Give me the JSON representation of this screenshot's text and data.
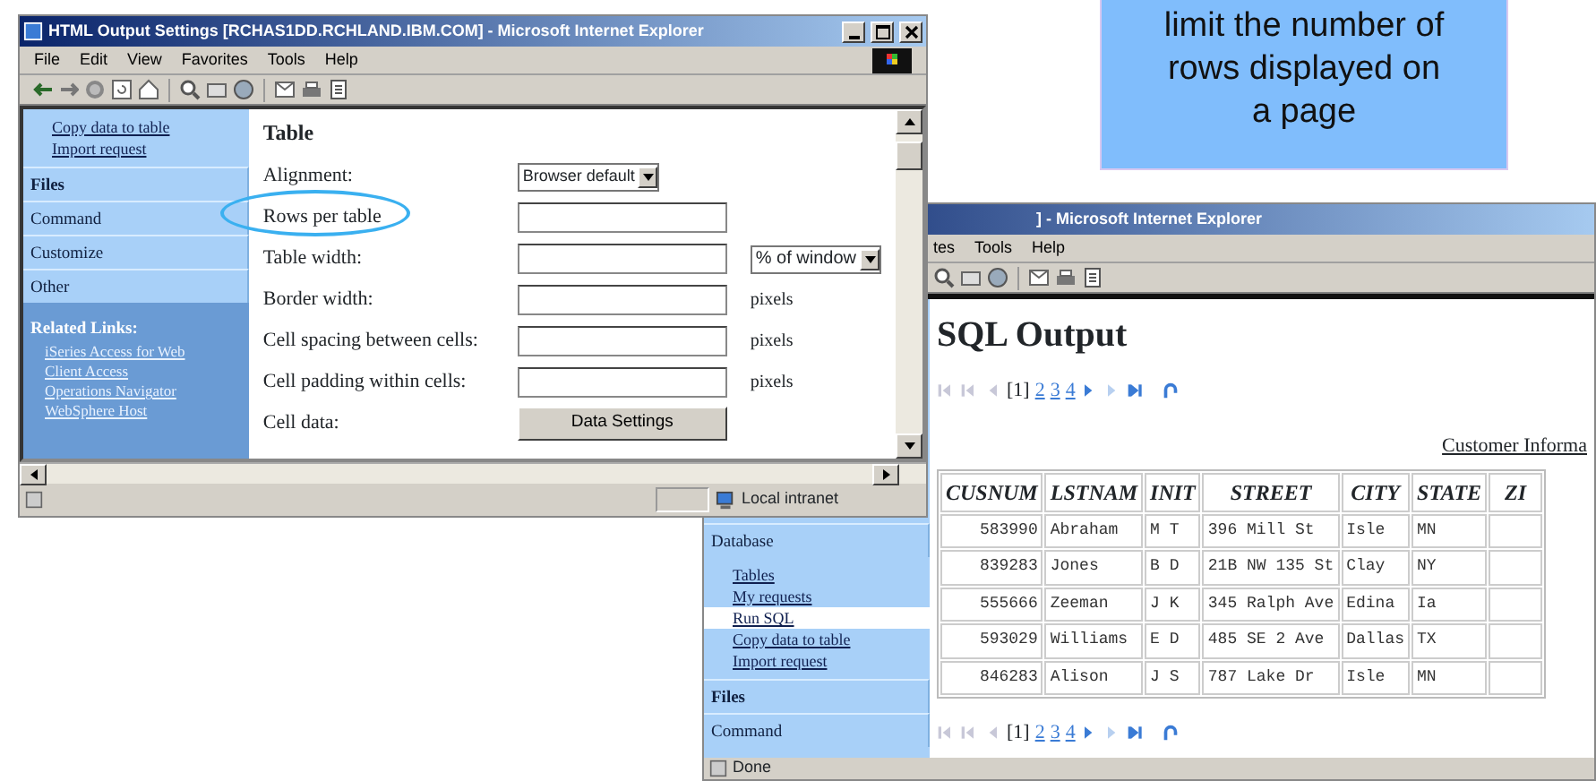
{
  "callout": {
    "lines": [
      "limit the number of",
      "rows displayed on",
      "a page"
    ]
  },
  "settings_window": {
    "title": "HTML Output Settings [RCHAS1DD.RCHLAND.IBM.COM] - Microsoft Internet Explorer",
    "menu": [
      "File",
      "Edit",
      "View",
      "Favorites",
      "Tools",
      "Help"
    ],
    "sidebar": {
      "links": [
        "Copy data to table",
        "Import request"
      ],
      "tabs": [
        "Files",
        "Command",
        "Customize",
        "Other"
      ],
      "related_title": "Related Links:",
      "related_links": [
        "iSeries Access for Web",
        "Client Access",
        "Operations Navigator",
        "WebSphere Host"
      ]
    },
    "form": {
      "heading": "Table",
      "rows": [
        {
          "label": "Alignment:",
          "circled": false,
          "field": {
            "kind": "select",
            "value": "Browser default"
          }
        },
        {
          "label": "Rows per table",
          "circled": true,
          "field": {
            "kind": "input"
          }
        },
        {
          "label": "Table width:",
          "circled": false,
          "field": {
            "kind": "input"
          },
          "extra": {
            "kind": "select",
            "value": "% of window"
          }
        },
        {
          "label": "Border width:",
          "circled": false,
          "field": {
            "kind": "input"
          },
          "extra": {
            "kind": "text",
            "value": "pixels"
          }
        },
        {
          "label": "Cell spacing between cells:",
          "circled": false,
          "field": {
            "kind": "input"
          },
          "extra": {
            "kind": "text",
            "value": "pixels"
          }
        },
        {
          "label": "Cell padding within cells:",
          "circled": false,
          "field": {
            "kind": "input"
          },
          "extra": {
            "kind": "text",
            "value": "pixels"
          }
        },
        {
          "label": "Cell data:",
          "circled": false,
          "field": {
            "kind": "button",
            "value": "Data Settings"
          }
        }
      ]
    },
    "status": "Local intranet"
  },
  "output_window": {
    "title": "] - Microsoft Internet Explorer",
    "menu": [
      "tes",
      "Tools",
      "Help"
    ],
    "sidebar": {
      "section": "Database",
      "links": [
        {
          "label": "Tables",
          "selected": false
        },
        {
          "label": "My requests",
          "selected": false
        },
        {
          "label": "Run SQL",
          "selected": true
        },
        {
          "label": "Copy data to table",
          "selected": false
        },
        {
          "label": "Import request",
          "selected": false
        }
      ],
      "tabs": [
        "Files",
        "Command"
      ]
    },
    "heading": "SQL Output",
    "pager_top": {
      "current": "[1]",
      "pages": [
        "2",
        "3",
        "4"
      ]
    },
    "caption": "Customer Informa",
    "table": {
      "columns": [
        "CUSNUM",
        "LSTNAM",
        "INIT",
        "STREET",
        "CITY",
        "STATE",
        "ZI"
      ],
      "rows": [
        [
          "583990",
          "Abraham",
          "M T",
          "396 Mill St",
          "Isle",
          "MN",
          ""
        ],
        [
          "839283",
          "Jones",
          "B D",
          "21B NW 135 St",
          "Clay",
          "NY",
          ""
        ],
        [
          "555666",
          "Zeeman",
          "J K",
          "345 Ralph Ave",
          "Edina",
          "Ia",
          ""
        ],
        [
          "593029",
          "Williams",
          "E D",
          "485 SE 2 Ave",
          "Dallas",
          "TX",
          ""
        ],
        [
          "846283",
          "Alison",
          "J S",
          "787 Lake Dr",
          "Isle",
          "MN",
          ""
        ]
      ]
    },
    "pager_bottom": {
      "current": "[1]",
      "pages": [
        "2",
        "3",
        "4"
      ]
    },
    "status": "Done"
  }
}
